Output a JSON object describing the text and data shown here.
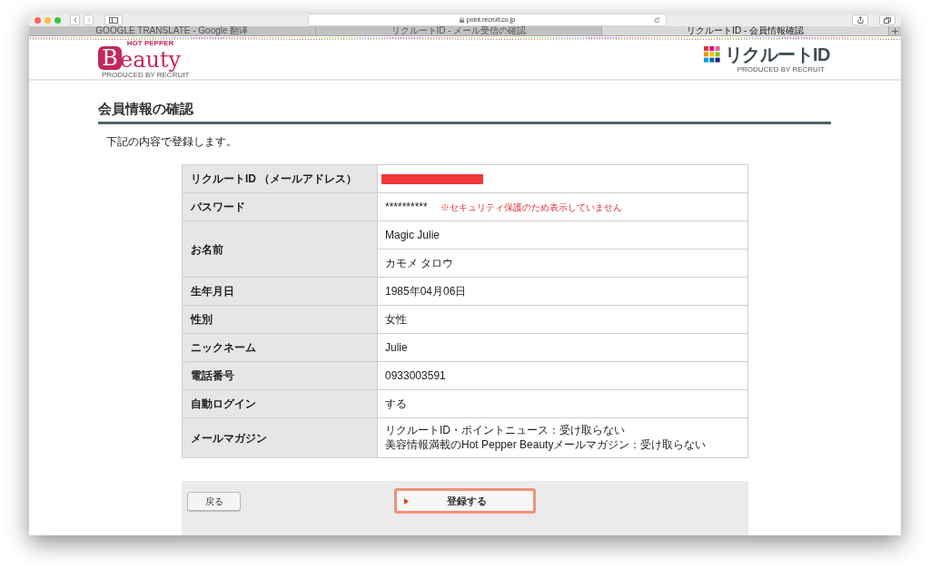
{
  "browser": {
    "url": "point.recruit.co.jp",
    "tabs": [
      {
        "label": "GOOGLE TRANSLATE - Google 翻译",
        "selected": false
      },
      {
        "label": "リクルートID - メール受信の確認",
        "selected": false
      },
      {
        "label": "リクルートID - 会員情報確認",
        "selected": true
      }
    ]
  },
  "header": {
    "left_logo": {
      "top": "HOT PEPPER",
      "initial": "B",
      "rest": "eauty",
      "byline": "PRODUCED BY RECRUIT"
    },
    "right_logo": {
      "name": "リクルートID",
      "byline": "PRODUCED BY RECRUIT"
    }
  },
  "page_title": "会員情報の確認",
  "intro": "下記の内容で登録します。",
  "rows": [
    {
      "label": "リクルートID （メールアドレス）",
      "cells": [
        {
          "kind": "redacted"
        }
      ]
    },
    {
      "label": "パスワード",
      "cells": [
        {
          "kind": "text",
          "lines": [
            "**********"
          ],
          "note": "※セキュリティ保護のため表示していません"
        }
      ]
    },
    {
      "label": "お名前",
      "cells": [
        {
          "kind": "text",
          "lines": [
            "Magic Julie"
          ]
        },
        {
          "kind": "text",
          "lines": [
            "カモメ タロウ"
          ]
        }
      ]
    },
    {
      "label": "生年月日",
      "cells": [
        {
          "kind": "text",
          "lines": [
            "1985年04月06日"
          ]
        }
      ]
    },
    {
      "label": "性別",
      "cells": [
        {
          "kind": "text",
          "lines": [
            "女性"
          ]
        }
      ]
    },
    {
      "label": "ニックネーム",
      "cells": [
        {
          "kind": "text",
          "lines": [
            "Julie"
          ]
        }
      ]
    },
    {
      "label": "電話番号",
      "cells": [
        {
          "kind": "text",
          "lines": [
            "0933003591"
          ]
        }
      ]
    },
    {
      "label": "自動ログイン",
      "cells": [
        {
          "kind": "text",
          "lines": [
            "する"
          ]
        }
      ]
    },
    {
      "label": "メールマガジン",
      "cells": [
        {
          "kind": "text",
          "lines": [
            "リクルートID・ポイントニュース：受け取らない",
            "美容情報満載のHot Pepper Beautyメールマガジン：受け取らない"
          ]
        }
      ]
    }
  ],
  "buttons": {
    "back": "戻る",
    "submit": "登録する"
  }
}
